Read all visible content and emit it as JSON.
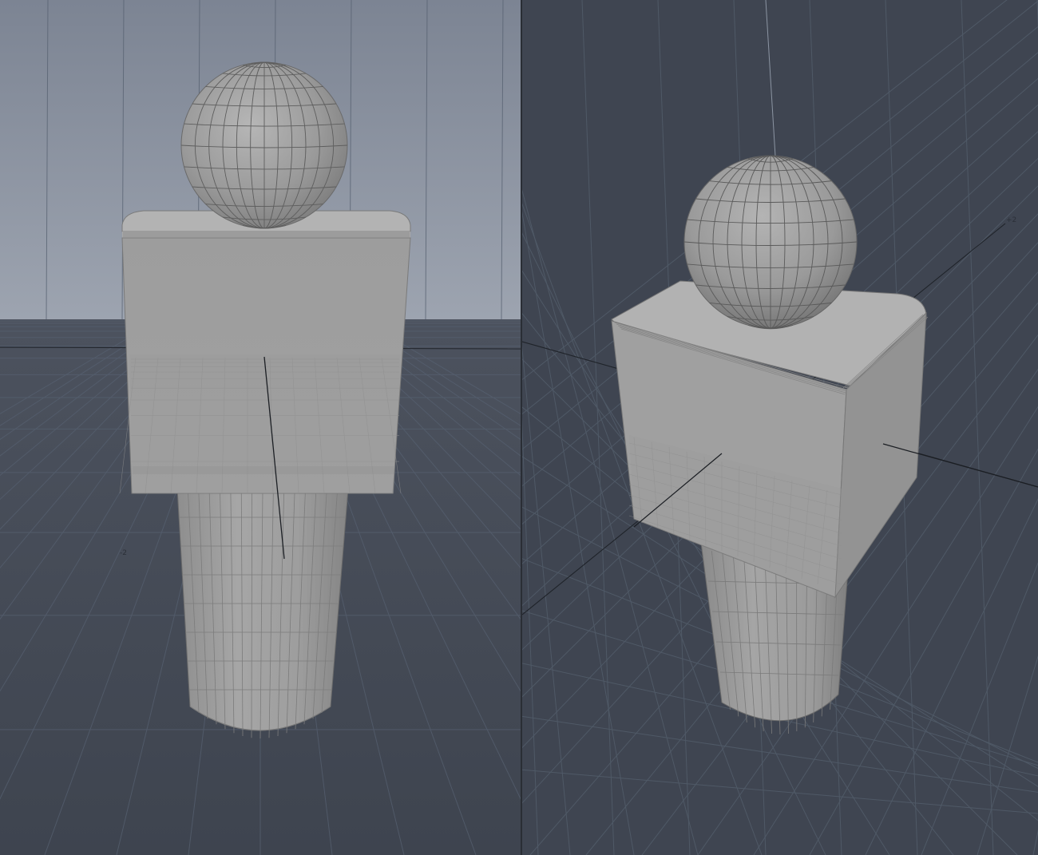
{
  "viewports": {
    "left": {
      "view": "perspective-front",
      "axis_label": "-2",
      "colors": {
        "sky_top": "#7f8795",
        "sky_bottom": "#9aa1ad",
        "ground": "#434955",
        "grid_line": "#525966",
        "mesh": "#a4a4a4",
        "wire": "#5e5e5e"
      }
    },
    "right": {
      "view": "perspective-angled",
      "axis_label": "+2",
      "colors": {
        "background": "#3f4551",
        "grid_line": "#525966",
        "mesh": "#a4a4a4",
        "wire": "#5e5e5e"
      }
    }
  },
  "model": {
    "parts": [
      "sphere-head",
      "beveled-box-body",
      "cylinder-stem"
    ]
  }
}
